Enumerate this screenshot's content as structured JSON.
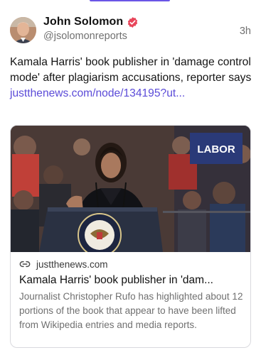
{
  "post": {
    "author": {
      "name": "John Solomon",
      "handle": "@jsolomonreports",
      "verified": true
    },
    "timestamp": "3h",
    "text": "Kamala Harris' book publisher in 'damage control mode' after plagiarism accusations, reporter says ",
    "link_text": "justthenews.com/node/134195?ut..."
  },
  "link_card": {
    "image_sign_text": "LABOR",
    "domain": "justthenews.com",
    "title": "Kamala Harris' book publisher in 'dam...",
    "description": "Journalist Christopher Rufo has highlighted about 12 portions of the book that appear to have been lifted from Wikipedia entries and media reports."
  },
  "colors": {
    "accent": "#6a55e6",
    "link": "#5b4bd8",
    "verified_badge": "#e8455a",
    "secondary_text": "#707070"
  },
  "icons": {
    "verified": "verified-badge-icon",
    "link": "link-icon"
  }
}
